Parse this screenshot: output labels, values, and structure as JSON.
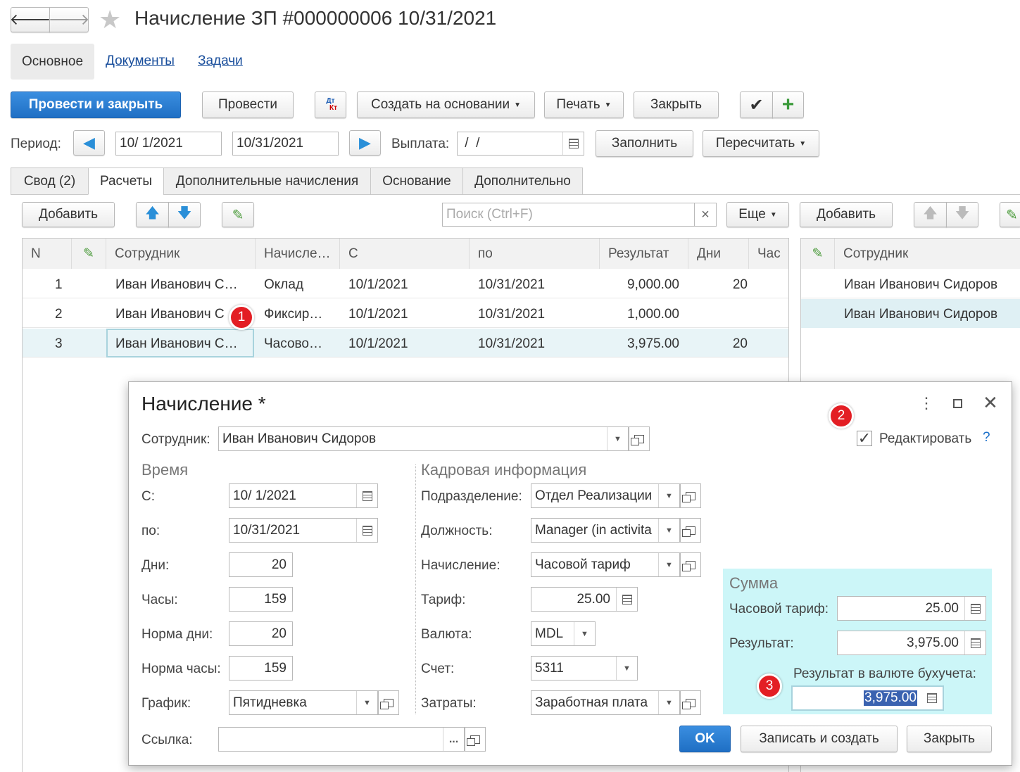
{
  "window": {
    "title": "Начисление ЗП #000000006 10/31/2021"
  },
  "nav": {
    "back": "🡐",
    "forward": "🡒"
  },
  "section_tabs": [
    "Основное",
    "Документы",
    "Задачи"
  ],
  "toolbar": {
    "post_close": "Провести и закрыть",
    "post": "Провести",
    "dtkt_top": "Дт",
    "dtkt_bottom": "Кт",
    "create_based": "Создать на основании",
    "print": "Печать",
    "close": "Закрыть"
  },
  "period": {
    "label": "Период:",
    "from": "10/ 1/2021",
    "to": "10/31/2021",
    "payment_label": "Выплата:",
    "payment_value": " /  /",
    "fill": "Заполнить",
    "recalc": "Пересчитать"
  },
  "tabs": [
    "Свод (2)",
    "Расчеты",
    "Дополнительные начисления",
    "Основание",
    "Дополнительно"
  ],
  "list_toolbar": {
    "add": "Добавить",
    "search_placeholder": "Поиск (Ctrl+F)",
    "clear": "×",
    "more": "Еще",
    "add_right": "Добавить"
  },
  "table": {
    "headers": [
      "N",
      "Сотрудник",
      "Начисле…",
      "С",
      "по",
      "Результат",
      "Дни",
      "Час"
    ],
    "rows": [
      {
        "n": "1",
        "employee": "Иван Иванович С…",
        "accrual": "Оклад",
        "from": "10/1/2021",
        "to": "10/31/2021",
        "result": "9,000.00",
        "days": "20"
      },
      {
        "n": "2",
        "employee": "Иван Иванович С",
        "accrual": "Фиксир…",
        "from": "10/1/2021",
        "to": "10/31/2021",
        "result": "1,000.00",
        "days": ""
      },
      {
        "n": "3",
        "employee": "Иван Иванович С…",
        "accrual": "Часово…",
        "from": "10/1/2021",
        "to": "10/31/2021",
        "result": "3,975.00",
        "days": "20"
      }
    ]
  },
  "right_table": {
    "header": "Сотрудник",
    "rows": [
      "Иван Иванович Сидоров",
      "Иван Иванович Сидоров"
    ]
  },
  "badges": [
    "1",
    "2",
    "3"
  ],
  "dialog": {
    "title": "Начисление *",
    "employee_label": "Сотрудник:",
    "employee_value": "Иван Иванович Сидоров",
    "edit_label": "Редактировать",
    "help": "?",
    "time": {
      "header": "Время",
      "from_label": "С:",
      "from_value": "10/ 1/2021",
      "to_label": "по:",
      "to_value": "10/31/2021",
      "days_label": "Дни:",
      "days_value": "20",
      "hours_label": "Часы:",
      "hours_value": "159",
      "norm_days_label": "Норма дни:",
      "norm_days_value": "20",
      "norm_hours_label": "Норма часы:",
      "norm_hours_value": "159",
      "schedule_label": "График:",
      "schedule_value": "Пятидневка"
    },
    "hr": {
      "header": "Кадровая информация",
      "dept_label": "Подразделение:",
      "dept_value": "Отдел Реализации",
      "position_label": "Должность:",
      "position_value": "Manager (in activita",
      "accrual_label": "Начисление:",
      "accrual_value": "Часовой тариф",
      "rate_label": "Тариф:",
      "rate_value": "25.00",
      "currency_label": "Валюта:",
      "currency_value": "MDL",
      "account_label": "Счет:",
      "account_value": "5311",
      "costs_label": "Затраты:",
      "costs_value": "Заработная плата"
    },
    "sum": {
      "header": "Сумма",
      "hourly_label": "Часовой тариф:",
      "hourly_value": "25.00",
      "result_label": "Результат:",
      "result_value": "3,975.00",
      "acc_label": "Результат в валюте бухучета:",
      "acc_value": "3,975.00"
    },
    "link_label": "Ссылка:",
    "link_dots": "...",
    "ok": "OK",
    "save_create": "Записать и создать",
    "close": "Закрыть"
  }
}
